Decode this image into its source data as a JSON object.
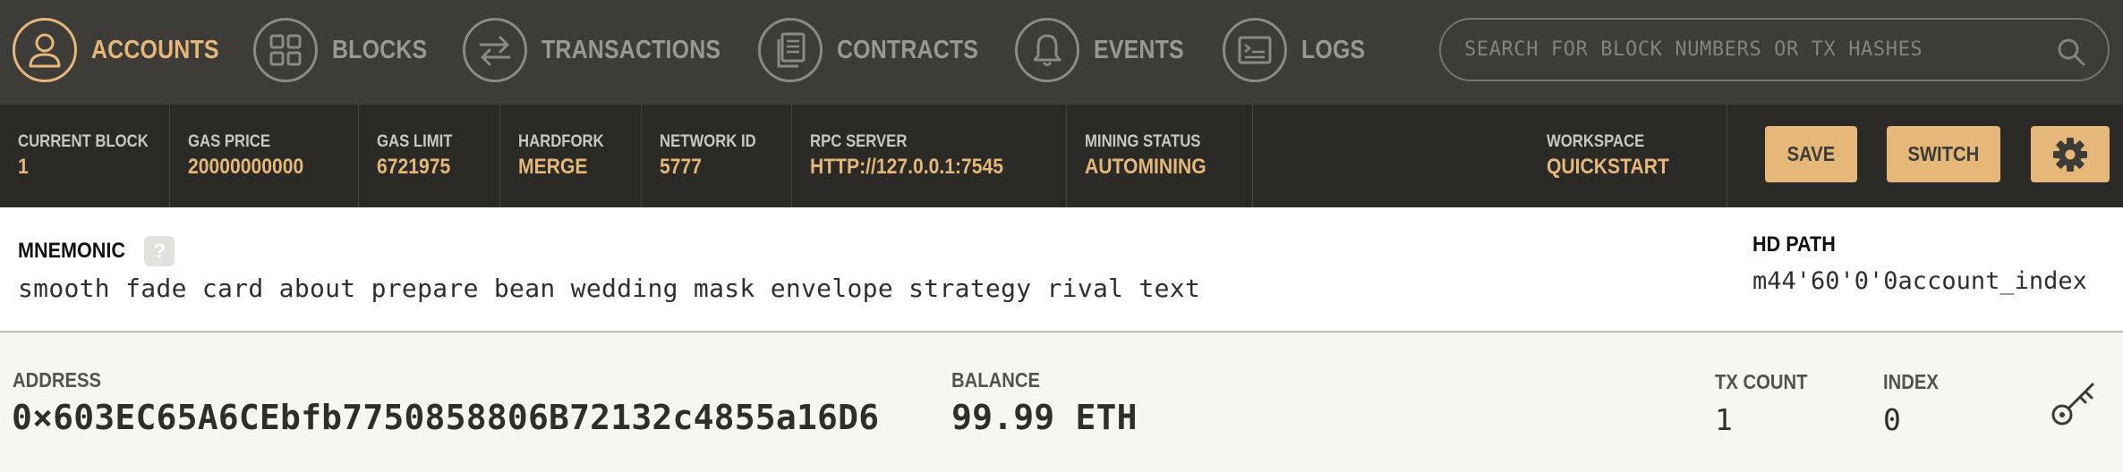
{
  "nav": {
    "items": [
      {
        "label": "ACCOUNTS",
        "icon": "account-icon",
        "active": true
      },
      {
        "label": "BLOCKS",
        "icon": "blocks-icon",
        "active": false
      },
      {
        "label": "TRANSACTIONS",
        "icon": "transactions-icon",
        "active": false
      },
      {
        "label": "CONTRACTS",
        "icon": "contracts-icon",
        "active": false
      },
      {
        "label": "EVENTS",
        "icon": "bell-icon",
        "active": false
      },
      {
        "label": "LOGS",
        "icon": "logs-icon",
        "active": false
      }
    ],
    "search": {
      "placeholder": "SEARCH FOR BLOCK NUMBERS OR TX HASHES",
      "value": ""
    }
  },
  "status": {
    "current_block": {
      "label": "CURRENT BLOCK",
      "value": "1"
    },
    "gas_price": {
      "label": "GAS PRICE",
      "value": "20000000000"
    },
    "gas_limit": {
      "label": "GAS LIMIT",
      "value": "6721975"
    },
    "hardfork": {
      "label": "HARDFORK",
      "value": "MERGE"
    },
    "network_id": {
      "label": "NETWORK ID",
      "value": "5777"
    },
    "rpc_server": {
      "label": "RPC SERVER",
      "value": "HTTP://127.0.0.1:7545"
    },
    "mining_status": {
      "label": "MINING STATUS",
      "value": "AUTOMINING"
    },
    "workspace": {
      "label": "WORKSPACE",
      "value": "QUICKSTART"
    },
    "save_label": "SAVE",
    "switch_label": "SWITCH",
    "settings_icon": "gear-icon"
  },
  "mnemonic": {
    "title": "MNEMONIC",
    "help": "?",
    "words": "smooth fade card about prepare bean wedding mask envelope strategy rival text",
    "hd_path_label": "HD PATH",
    "hd_path_value": "m44'60'0'0account_index"
  },
  "account": {
    "address_label": "ADDRESS",
    "address": "0×603EC65A6CEbfb7750858806B72132c4855a16D6",
    "balance_label": "BALANCE",
    "balance": "99.99 ETH",
    "tx_count_label": "TX COUNT",
    "tx_count": "1",
    "index_label": "INDEX",
    "index": "0",
    "key_icon": "key-icon"
  },
  "colors": {
    "accent": "#e5b778",
    "nav_bg": "#3d3c38",
    "status_bg": "#2b2a27",
    "page_bg": "#f7f6f3"
  }
}
